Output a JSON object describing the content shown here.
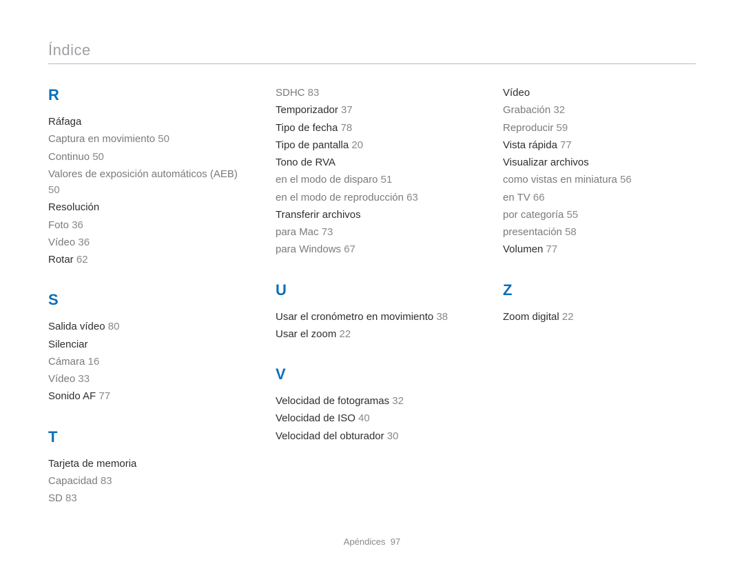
{
  "header": {
    "title": "Índice"
  },
  "footer": {
    "section": "Apéndices",
    "page": "97"
  },
  "columns": [
    {
      "letters": [
        {
          "letter": "R",
          "topics": [
            {
              "label": "Ráfaga",
              "page": null,
              "subs": [
                {
                  "label": "Captura en movimiento",
                  "page": "50"
                },
                {
                  "label": "Continuo",
                  "page": "50"
                },
                {
                  "label": "Valores de exposición automáticos (AEB)",
                  "page": "50"
                }
              ]
            },
            {
              "label": "Resolución",
              "page": null,
              "subs": [
                {
                  "label": "Foto",
                  "page": "36"
                },
                {
                  "label": "Vídeo",
                  "page": "36"
                }
              ]
            },
            {
              "label": "Rotar",
              "page": "62",
              "subs": []
            }
          ]
        },
        {
          "letter": "S",
          "topics": [
            {
              "label": "Salida vídeo",
              "page": "80",
              "subs": []
            },
            {
              "label": "Silenciar",
              "page": null,
              "subs": [
                {
                  "label": "Cámara",
                  "page": "16"
                },
                {
                  "label": "Vídeo",
                  "page": "33"
                }
              ]
            },
            {
              "label": "Sonido AF",
              "page": "77",
              "subs": []
            }
          ]
        },
        {
          "letter": "T",
          "topics": [
            {
              "label": "Tarjeta de memoria",
              "page": null,
              "subs": [
                {
                  "label": "Capacidad",
                  "page": "83"
                },
                {
                  "label": "SD",
                  "page": "83"
                }
              ]
            }
          ]
        }
      ]
    },
    {
      "letters": [
        {
          "letter": null,
          "topics": [
            {
              "label": null,
              "page": null,
              "subs": [
                {
                  "label": "SDHC",
                  "page": "83"
                }
              ]
            },
            {
              "label": "Temporizador",
              "page": "37",
              "subs": []
            },
            {
              "label": "Tipo de fecha",
              "page": "78",
              "subs": []
            },
            {
              "label": "Tipo de pantalla",
              "page": "20",
              "subs": []
            },
            {
              "label": "Tono de RVA",
              "page": null,
              "subs": [
                {
                  "label": "en el modo de disparo",
                  "page": "51"
                },
                {
                  "label": "en el modo de reproducción",
                  "page": "63"
                }
              ]
            },
            {
              "label": "Transferir archivos",
              "page": null,
              "subs": [
                {
                  "label": "para Mac",
                  "page": "73"
                },
                {
                  "label": "para Windows",
                  "page": "67"
                }
              ]
            }
          ]
        },
        {
          "letter": "U",
          "topics": [
            {
              "label": "Usar el cronómetro en movimiento",
              "page": "38",
              "subs": []
            },
            {
              "label": "Usar el zoom",
              "page": "22",
              "subs": []
            }
          ]
        },
        {
          "letter": "V",
          "topics": [
            {
              "label": "Velocidad de fotogramas",
              "page": "32",
              "subs": []
            },
            {
              "label": "Velocidad de ISO",
              "page": "40",
              "subs": []
            },
            {
              "label": "Velocidad del obturador",
              "page": "30",
              "subs": []
            }
          ]
        }
      ]
    },
    {
      "letters": [
        {
          "letter": null,
          "topics": [
            {
              "label": "Vídeo",
              "page": null,
              "subs": [
                {
                  "label": "Grabación",
                  "page": "32"
                },
                {
                  "label": "Reproducir",
                  "page": "59"
                }
              ]
            },
            {
              "label": "Vista rápida",
              "page": "77",
              "subs": []
            },
            {
              "label": "Visualizar archivos",
              "page": null,
              "subs": [
                {
                  "label": "como vistas en miniatura",
                  "page": "56"
                },
                {
                  "label": "en TV",
                  "page": "66"
                },
                {
                  "label": "por categoría",
                  "page": "55"
                },
                {
                  "label": "presentación",
                  "page": "58"
                }
              ]
            },
            {
              "label": "Volumen",
              "page": "77",
              "subs": []
            }
          ]
        },
        {
          "letter": "Z",
          "topics": [
            {
              "label": "Zoom digital",
              "page": "22",
              "subs": []
            }
          ]
        }
      ]
    }
  ]
}
